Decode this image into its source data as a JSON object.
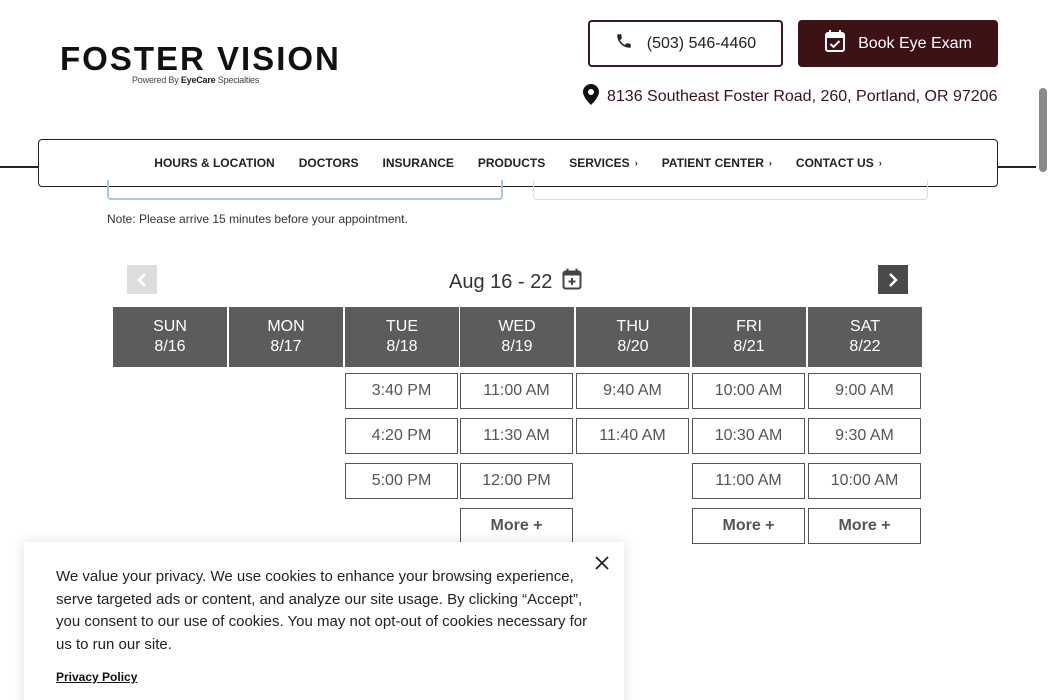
{
  "logo": {
    "name": "FOSTER VISION",
    "powered_prefix": "Powered By",
    "powered_brand": "EyeCare",
    "powered_suffix": "Specialties"
  },
  "header": {
    "phone_label": "(503) 546-4460",
    "book_label": "Book Eye Exam",
    "address": "8136 Southeast Foster Road, 260, Portland, OR 97206"
  },
  "nav": [
    {
      "label": "HOURS & LOCATION",
      "chevron": false
    },
    {
      "label": "DOCTORS",
      "chevron": false
    },
    {
      "label": "INSURANCE",
      "chevron": false
    },
    {
      "label": "PRODUCTS",
      "chevron": false
    },
    {
      "label": "SERVICES",
      "chevron": true
    },
    {
      "label": "PATIENT CENTER",
      "chevron": true
    },
    {
      "label": "CONTACT US",
      "chevron": true
    }
  ],
  "schedule": {
    "note": "Note: Please arrive 15 minutes before your appointment.",
    "week_label": "Aug 16 - 22",
    "days": [
      {
        "dow": "SUN",
        "date": "8/16",
        "slots": []
      },
      {
        "dow": "MON",
        "date": "8/17",
        "slots": []
      },
      {
        "dow": "TUE",
        "date": "8/18",
        "slots": [
          "3:40 PM",
          "4:20 PM",
          "5:00 PM"
        ]
      },
      {
        "dow": "WED",
        "date": "8/19",
        "slots": [
          "11:00 AM",
          "11:30 AM",
          "12:00 PM",
          "More +"
        ]
      },
      {
        "dow": "THU",
        "date": "8/20",
        "slots": [
          "9:40 AM",
          "11:40 AM"
        ]
      },
      {
        "dow": "FRI",
        "date": "8/21",
        "slots": [
          "10:00 AM",
          "10:30 AM",
          "11:00 AM",
          "More +"
        ]
      },
      {
        "dow": "SAT",
        "date": "8/22",
        "slots": [
          "9:00 AM",
          "9:30 AM",
          "10:00 AM",
          "More +"
        ]
      }
    ]
  },
  "cookie": {
    "text": "We value your privacy. We use cookies to enhance your browsing experience, serve targeted ads or content, and analyze our site usage. By clicking “Accept”, you consent to our use of cookies. You may not opt-out of cookies necessary for us to run our site.",
    "policy_link": "Privacy Policy"
  },
  "colors": {
    "brand": "#3d1215",
    "day_header": "#5c5c5c"
  }
}
